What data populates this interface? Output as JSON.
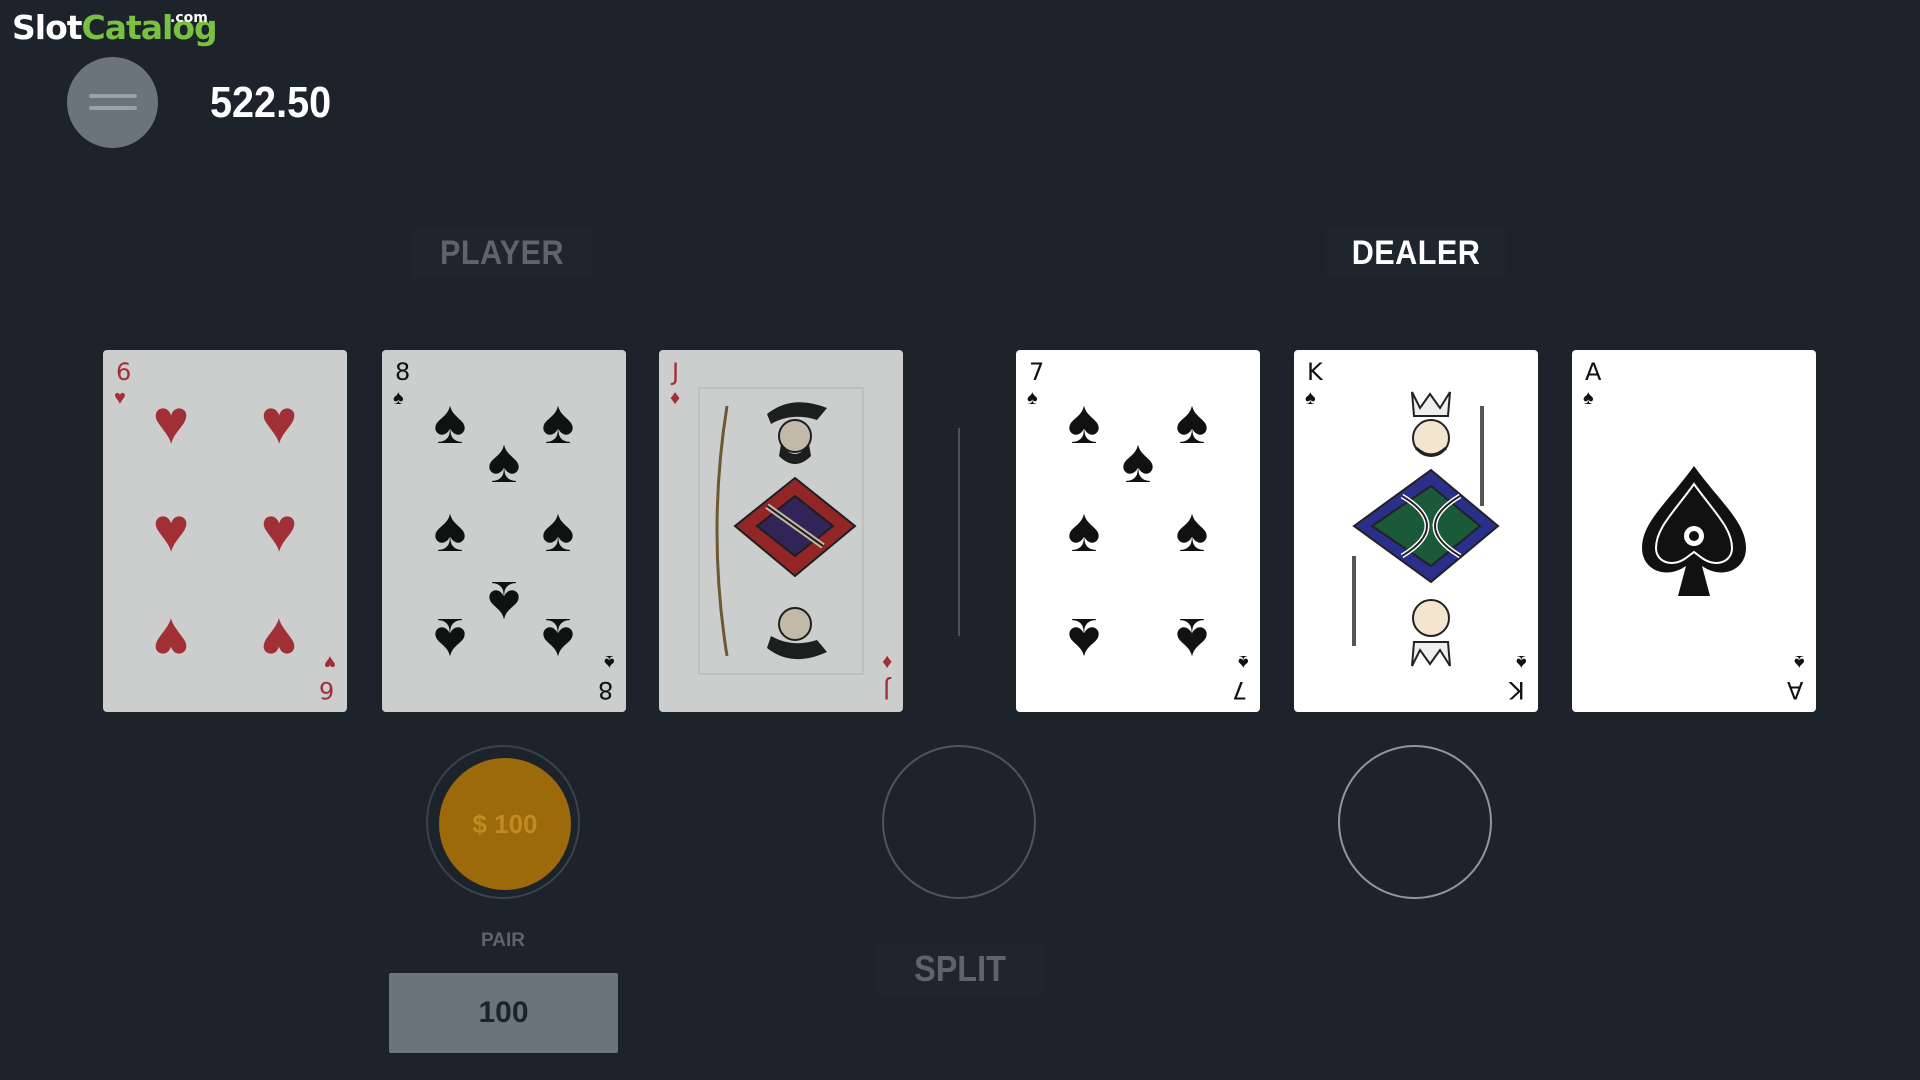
{
  "logo": {
    "slot": "Slot",
    "catalog": "Catalog",
    "dotcom": ".com"
  },
  "header": {
    "balance": "522.50",
    "menu_icon": "hamburger-menu-icon"
  },
  "labels": {
    "player": "PLAYER",
    "dealer": "DEALER",
    "pair": "PAIR",
    "split": "SPLIT"
  },
  "player_cards": [
    {
      "rank": "6",
      "suit": "♥",
      "suit_name": "hearts",
      "color": "#c8373d"
    },
    {
      "rank": "8",
      "suit": "♠",
      "suit_name": "spades",
      "color": "#111111"
    },
    {
      "rank": "J",
      "suit": "♦",
      "suit_name": "diamonds",
      "color": "#c8373d"
    }
  ],
  "dealer_cards": [
    {
      "rank": "7",
      "suit": "♠",
      "suit_name": "spades",
      "color": "#111111"
    },
    {
      "rank": "K",
      "suit": "♠",
      "suit_name": "spades",
      "color": "#111111"
    },
    {
      "rank": "A",
      "suit": "♠",
      "suit_name": "spades",
      "color": "#111111"
    }
  ],
  "bets": {
    "player_chip": "$ 100",
    "pair_value": "100"
  },
  "colors": {
    "background": "#1c232b",
    "brand_green": "#7ac142",
    "chip": "#9c6a0a",
    "red_suit": "#c8373d"
  }
}
